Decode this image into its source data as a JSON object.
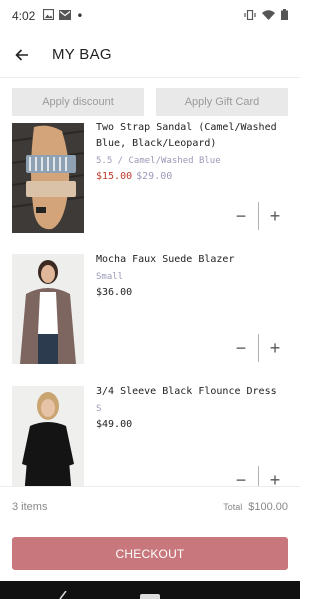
{
  "status": {
    "time": "4:02",
    "dot": "•"
  },
  "header": {
    "title": "MY BAG"
  },
  "promos": {
    "discount_label": "Apply discount",
    "gift_label": "Apply Gift Card"
  },
  "items": [
    {
      "name": "Two Strap Sandal (Camel/Washed Blue, Black/Leopard)",
      "variant": "5.5 / Camel/Washed Blue",
      "sale_price": "$15.00",
      "original_price": "$29.00"
    },
    {
      "name": "Mocha Faux Suede Blazer",
      "variant": "Small",
      "price": "$36.00"
    },
    {
      "name": "3/4 Sleeve Black Flounce Dress",
      "variant": "S",
      "price": "$49.00"
    }
  ],
  "stepper": {
    "minus": "−",
    "plus": "+"
  },
  "summary": {
    "count": "3 items",
    "total_label": "Total",
    "total_value": "$100.00"
  },
  "checkout": {
    "label": "CHECKOUT"
  },
  "colors": {
    "accent": "#c8787c",
    "sale": "#c0392b",
    "variant": "#9a9ab8",
    "promo_bg": "#e9e9e9"
  }
}
